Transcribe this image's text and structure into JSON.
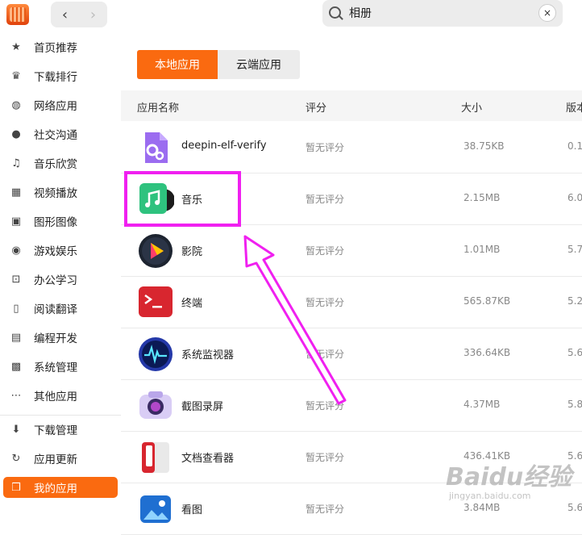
{
  "titlebar": {
    "search": {
      "value": "相册",
      "clear": "×"
    },
    "nav": {
      "back": "‹",
      "forward": "›"
    }
  },
  "sidebar": {
    "items": [
      {
        "label": "首页推荐",
        "icon": "star-icon",
        "glyph": "★"
      },
      {
        "label": "下载排行",
        "icon": "crown-icon",
        "glyph": "♛"
      },
      {
        "label": "网络应用",
        "icon": "globe-icon",
        "glyph": "◍"
      },
      {
        "label": "社交沟通",
        "icon": "chat-icon",
        "glyph": "●"
      },
      {
        "label": "音乐欣赏",
        "icon": "music-note-icon",
        "glyph": "♫"
      },
      {
        "label": "视频播放",
        "icon": "film-icon",
        "glyph": "▦"
      },
      {
        "label": "图形图像",
        "icon": "image-icon",
        "glyph": "▣"
      },
      {
        "label": "游戏娱乐",
        "icon": "gamepad-icon",
        "glyph": "◉"
      },
      {
        "label": "办公学习",
        "icon": "presentation-icon",
        "glyph": "⊡"
      },
      {
        "label": "阅读翻译",
        "icon": "book-icon",
        "glyph": "▯"
      },
      {
        "label": "编程开发",
        "icon": "terminal-icon",
        "glyph": "▤"
      },
      {
        "label": "系统管理",
        "icon": "system-icon",
        "glyph": "▩"
      },
      {
        "label": "其他应用",
        "icon": "more-icon",
        "glyph": "⋯"
      }
    ],
    "bottom_items": [
      {
        "label": "下载管理",
        "icon": "download-icon",
        "glyph": "⬇"
      },
      {
        "label": "应用更新",
        "icon": "update-icon",
        "glyph": "↻"
      },
      {
        "label": "我的应用",
        "icon": "box-icon",
        "glyph": "❒",
        "active": true
      }
    ]
  },
  "main": {
    "tabs": [
      {
        "label": "本地应用",
        "active": true
      },
      {
        "label": "云端应用",
        "active": false
      }
    ],
    "columns": {
      "name": "应用名称",
      "rating": "评分",
      "size": "大小",
      "version": "版本"
    },
    "rows": [
      {
        "name": "deepin-elf-verify",
        "rating": "暂无评分",
        "size": "38.75KB",
        "version": "0.1",
        "icon": "settings-gear-app-icon"
      },
      {
        "name": "音乐",
        "rating": "暂无评分",
        "size": "2.15MB",
        "version": "6.0",
        "icon": "music-app-icon"
      },
      {
        "name": "影院",
        "rating": "暂无评分",
        "size": "1.01MB",
        "version": "5.7",
        "icon": "movie-player-app-icon"
      },
      {
        "name": "终端",
        "rating": "暂无评分",
        "size": "565.87KB",
        "version": "5.2",
        "icon": "terminal-app-icon"
      },
      {
        "name": "系统监视器",
        "rating": "暂无评分",
        "size": "336.64KB",
        "version": "5.6",
        "icon": "system-monitor-app-icon"
      },
      {
        "name": "截图录屏",
        "rating": "暂无评分",
        "size": "4.37MB",
        "version": "5.8",
        "icon": "screenshot-camera-app-icon"
      },
      {
        "name": "文档查看器",
        "rating": "暂无评分",
        "size": "436.41KB",
        "version": "5.6",
        "icon": "document-viewer-app-icon"
      },
      {
        "name": "看图",
        "rating": "暂无评分",
        "size": "3.84MB",
        "version": "5.6",
        "icon": "image-viewer-app-icon"
      }
    ]
  },
  "watermark": {
    "brand": "Baidu经验",
    "url": "jingyan.baidu.com"
  },
  "colors": {
    "accent": "#fa6a10",
    "annotation": "#f020f0"
  }
}
